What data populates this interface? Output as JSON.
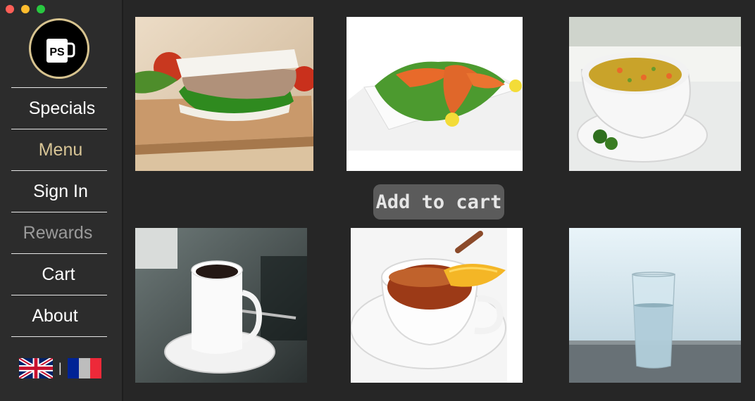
{
  "logo": {
    "text": "PS"
  },
  "nav": {
    "items": [
      {
        "label": "Specials",
        "color": "#ffffff"
      },
      {
        "label": "Menu",
        "color": "#d8c596"
      },
      {
        "label": "Sign In",
        "color": "#ffffff"
      },
      {
        "label": "Rewards",
        "color": "#9a9a9a"
      },
      {
        "label": "Cart",
        "color": "#ffffff"
      },
      {
        "label": "About",
        "color": "#ffffff"
      }
    ]
  },
  "language": {
    "separator": "|",
    "options": [
      "english-flag-icon",
      "french-flag-icon"
    ]
  },
  "products": [
    {
      "icon": "sandwich-icon"
    },
    {
      "icon": "grilled-chicken-salad-icon"
    },
    {
      "icon": "soup-icon"
    },
    {
      "icon": "coffee-icon"
    },
    {
      "icon": "tea-icon"
    },
    {
      "icon": "water-glass-icon"
    }
  ],
  "add_to_cart": {
    "label": "Add to cart"
  },
  "colors": {
    "background": "#262626",
    "sidebar": "#2c2c2c",
    "accent": "#d8c596",
    "button": "#5b5b5b"
  }
}
